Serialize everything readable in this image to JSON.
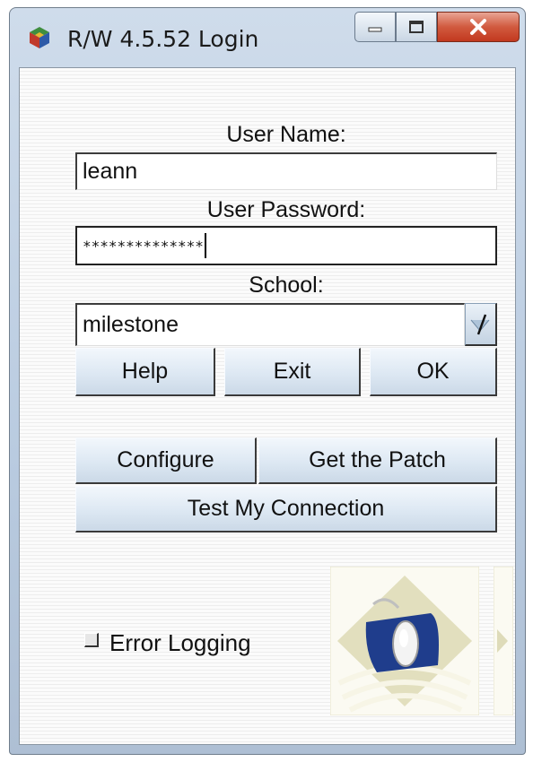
{
  "window": {
    "title": "R/W 4.5.52 Login",
    "icons": {
      "app": "cube-app-icon",
      "minimize": "minimize-icon",
      "maximize": "maximize-icon",
      "close": "close-x-icon"
    }
  },
  "form": {
    "username_label": "User Name:",
    "username_value": "leann",
    "password_label": "User Password:",
    "password_value": "**************",
    "school_label": "School:",
    "school_value": "milestone",
    "school_dropdown_icon": "dropdown-arrow-icon"
  },
  "buttons": {
    "help": "Help",
    "exit": "Exit",
    "ok": "OK",
    "configure": "Configure",
    "get_patch": "Get the Patch",
    "test_connection": "Test My Connection"
  },
  "options": {
    "error_logging_label": "Error Logging",
    "error_logging_checked": false
  },
  "logo": {
    "icon": "mouse-logo-icon"
  },
  "colors": {
    "titlebar": "#b9cbe0",
    "close_button": "#c7422a",
    "button_face": "#dde8f3",
    "logo_blue": "#1f3d8c",
    "logo_tan": "#e2dfbe"
  }
}
